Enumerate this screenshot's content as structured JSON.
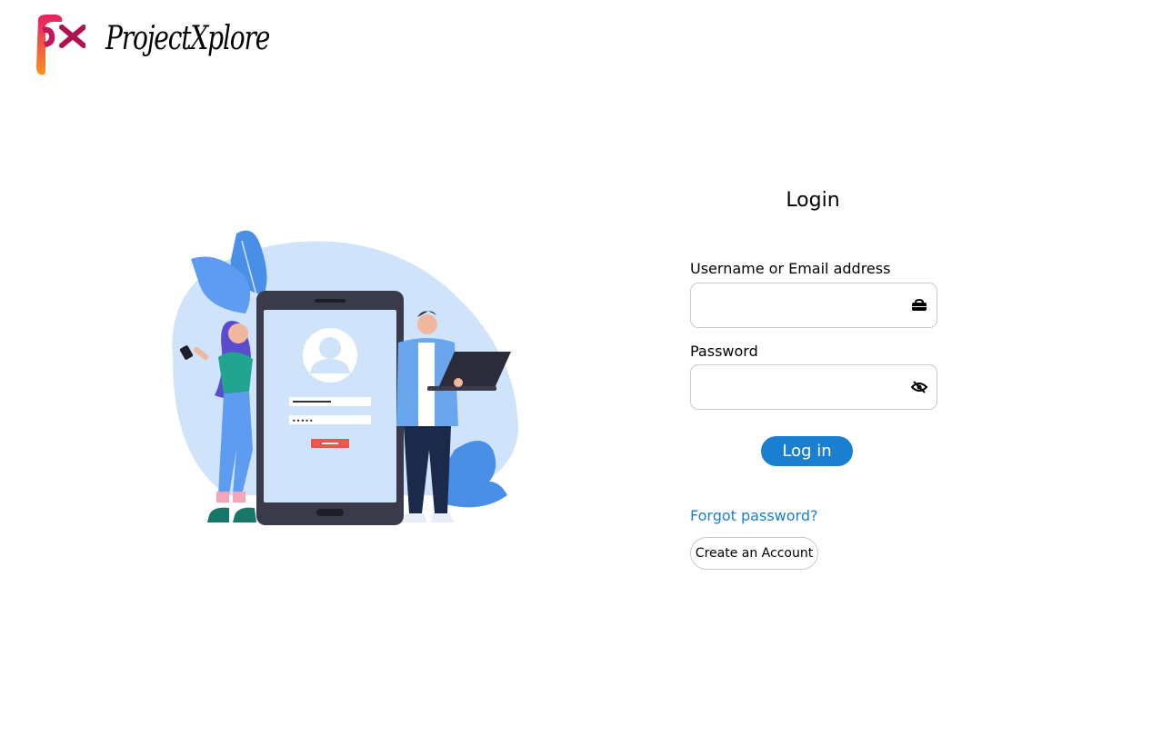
{
  "brand": {
    "name": "ProjectXplore",
    "logo_mark_text": "px"
  },
  "login": {
    "title": "Login",
    "username_label": "Username or Email address",
    "username_value": "",
    "password_label": "Password",
    "password_value": "",
    "submit_label": "Log in",
    "forgot_link": "Forgot password?",
    "create_account_label": "Create an Account"
  },
  "icons": {
    "username_icon": "id-badge-icon",
    "password_icon": "eye-slash-icon"
  },
  "colors": {
    "accent": "#1a7fd1",
    "illustration_bg": "#cfe3fb",
    "logo_magenta": "#c2185b",
    "logo_orange": "#f7931e"
  }
}
